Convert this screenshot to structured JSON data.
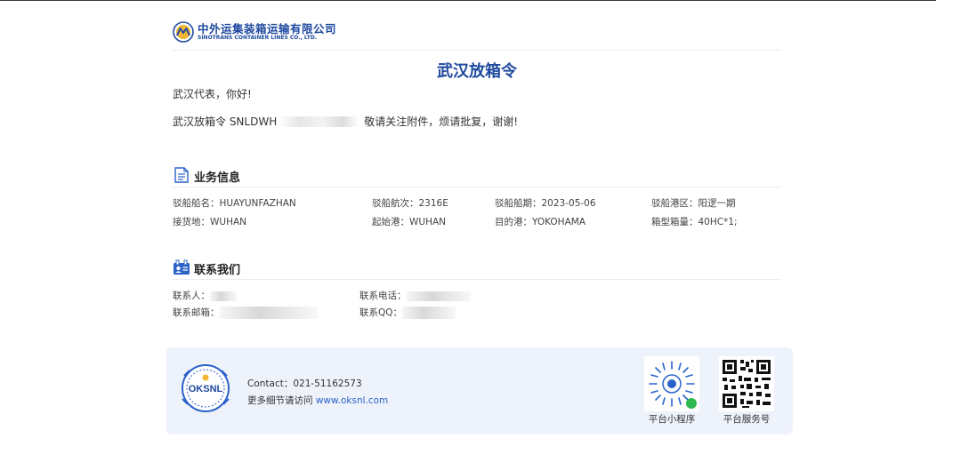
{
  "brand": {
    "name_cn": "中外运集装箱运输有限公司",
    "name_en": "SINOTRANS CONTAINER LINES CO., LTD."
  },
  "title": "武汉放箱令",
  "greeting": "武汉代表，你好!",
  "message": {
    "prefix": "武汉放箱令 SNLDWH",
    "suffix": "敬请关注附件，烦请批复，谢谢!"
  },
  "business": {
    "heading": "业务信息",
    "fields": [
      {
        "label": "驳船船名：",
        "value": "HUAYUNFAZHAN"
      },
      {
        "label": "驳船航次：",
        "value": "2316E"
      },
      {
        "label": "驳船船期：",
        "value": "2023-05-06"
      },
      {
        "label": "驳船港区：",
        "value": "阳逻一期"
      },
      {
        "label": "接货地：",
        "value": "WUHAN"
      },
      {
        "label": "起始港：",
        "value": "WUHAN"
      },
      {
        "label": "目的港：",
        "value": "YOKOHAMA"
      },
      {
        "label": "箱型箱量：",
        "value": "40HC*1;"
      }
    ]
  },
  "contact_us": {
    "heading": "联系我们",
    "person_label": "联系人：",
    "phone_label": "联系电话：",
    "email_label": "联系邮箱：",
    "qq_label": "联系QQ："
  },
  "footer": {
    "logo_text": "OKSNL",
    "contact": "Contact：021-51162573",
    "more_prefix": "更多细节请访问 ",
    "more_link": "www.oksnl.com",
    "qr_mini_label": "平台小程序",
    "qr_service_label": "平台服务号"
  },
  "colors": {
    "brand_blue": "#1f4aa0",
    "link_blue": "#2a62c9",
    "footer_bg": "#eef2fb"
  }
}
